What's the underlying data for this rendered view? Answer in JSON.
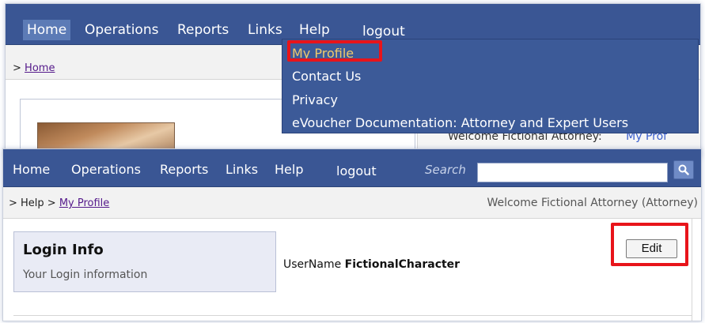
{
  "top_nav": {
    "items": [
      "Home",
      "Operations",
      "Reports",
      "Links",
      "Help"
    ],
    "logout": "logout"
  },
  "top_breadcrumb": {
    "prefix": ">",
    "home": "Home"
  },
  "help_menu": {
    "items": [
      "My Profile",
      "Contact Us",
      "Privacy",
      "eVoucher Documentation: Attorney and Expert Users"
    ]
  },
  "top_welcome": {
    "text": "Welcome Fictional Attorney:",
    "link": "My Prof"
  },
  "bottom_nav": {
    "items": [
      "Home",
      "Operations",
      "Reports",
      "Links",
      "Help"
    ],
    "logout": "logout",
    "search_label": "Search",
    "search_value": ""
  },
  "bottom_breadcrumb": {
    "prefix": "> Help >",
    "current": "My Profile",
    "welcome": "Welcome Fictional Attorney (Attorney)"
  },
  "login_info": {
    "title": "Login Info",
    "subtitle": "Your Login information",
    "username_label": "UserName",
    "username_value": "FictionalCharacter",
    "edit_label": "Edit"
  },
  "colors": {
    "nav_bg": "#3a5694",
    "highlight": "#e8141a",
    "menu_highlight_text": "#f0c96b"
  }
}
